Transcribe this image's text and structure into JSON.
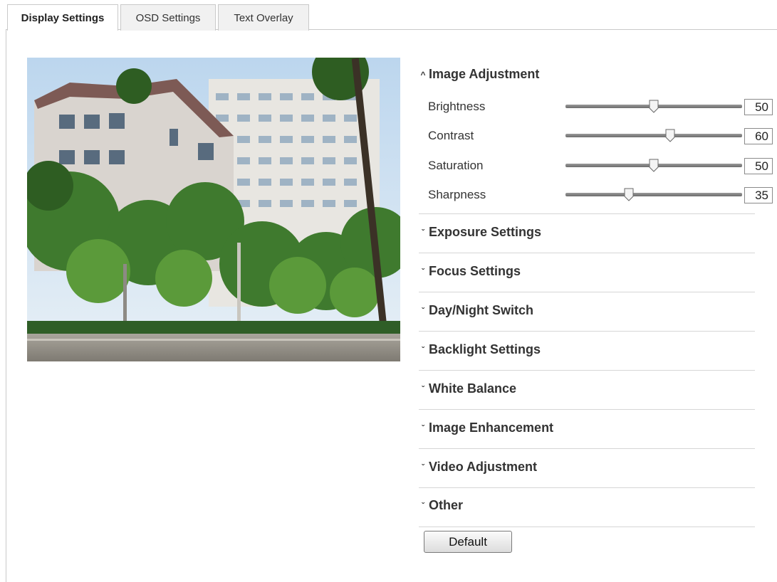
{
  "tabs": [
    {
      "label": "Display Settings",
      "active": true
    },
    {
      "label": "OSD Settings",
      "active": false
    },
    {
      "label": "Text Overlay",
      "active": false
    }
  ],
  "preview": {
    "icon": "camera-live-preview"
  },
  "image_adjustment": {
    "title": "Image Adjustment",
    "expanded": true,
    "sliders": [
      {
        "label": "Brightness",
        "value": "50",
        "fraction": 0.5
      },
      {
        "label": "Contrast",
        "value": "60",
        "fraction": 0.6
      },
      {
        "label": "Saturation",
        "value": "50",
        "fraction": 0.5
      },
      {
        "label": "Sharpness",
        "value": "35",
        "fraction": 0.35
      }
    ]
  },
  "sections": [
    {
      "title": "Exposure Settings",
      "expanded": false
    },
    {
      "title": "Focus Settings",
      "expanded": false
    },
    {
      "title": "Day/Night Switch",
      "expanded": false
    },
    {
      "title": "Backlight Settings",
      "expanded": false
    },
    {
      "title": "White Balance",
      "expanded": false
    },
    {
      "title": "Image Enhancement",
      "expanded": false
    },
    {
      "title": "Video Adjustment",
      "expanded": false
    },
    {
      "title": "Other",
      "expanded": false
    }
  ],
  "icons": {
    "expanded": "chevron-up-icon",
    "collapsed": "chevron-down-icon"
  },
  "default_button": "Default",
  "colors": {
    "border": "#c9c9c9",
    "divider": "#d6d6d6",
    "text": "#333333"
  }
}
